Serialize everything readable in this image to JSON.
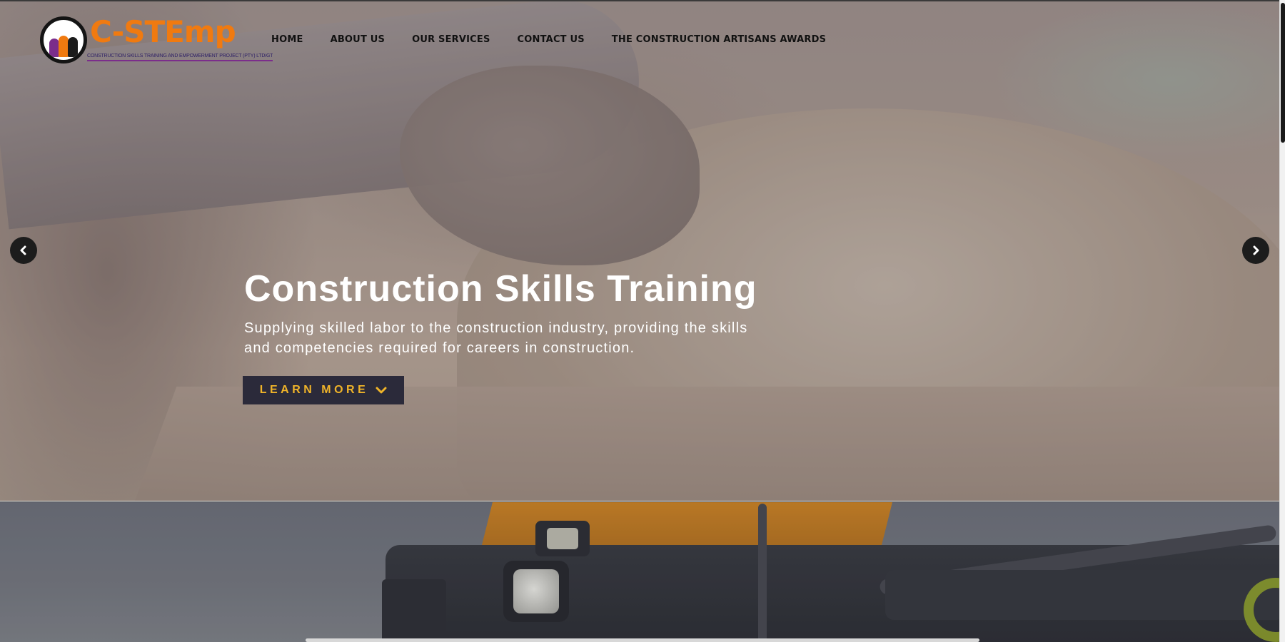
{
  "header": {
    "logo_word": "C-STEmp",
    "logo_tagline": "CONSTRUCTION SKILLS TRAINING AND EMPOWERMENT PROJECT (PTY) LTD/GTEE",
    "nav": [
      {
        "label": "HOME"
      },
      {
        "label": "ABOUT US"
      },
      {
        "label": "OUR SERVICES"
      },
      {
        "label": "CONTACT US"
      },
      {
        "label": "THE CONSTRUCTION ARTISANS AWARDS"
      }
    ]
  },
  "hero": {
    "title": "Construction Skills Training",
    "subtitle": "Supplying skilled labor to the construction industry, providing the skills and competencies required for careers in construction.",
    "cta_label": "LEARN MORE",
    "cta_icon": "chevron-down-icon",
    "prev_icon": "chevron-left-icon",
    "next_icon": "chevron-right-icon"
  },
  "colors": {
    "brand_orange": "#f07a10",
    "brand_purple": "#7b2d8b",
    "cta_background": "#2b2a3a",
    "cta_text": "#f0b429",
    "nav_text": "#111111"
  }
}
